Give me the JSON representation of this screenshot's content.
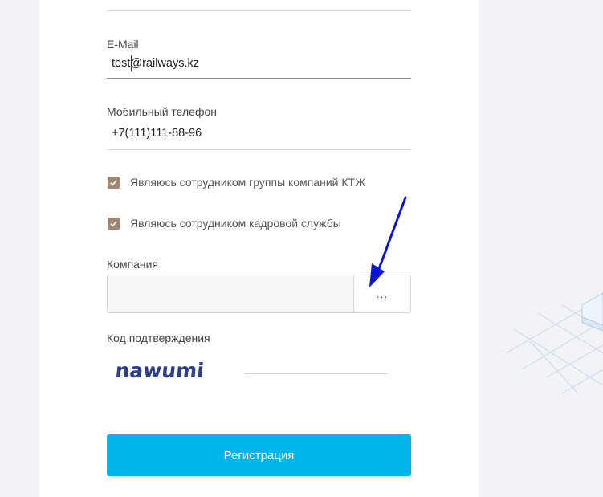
{
  "form": {
    "email": {
      "label": "E-Mail",
      "value": "test@railways.kz"
    },
    "phone": {
      "label": "Мобильный телефон",
      "value": "+7(111)111-88-96"
    },
    "checkbox_ktzh": {
      "label": "Являюсь сотрудником группы компаний КТЖ",
      "checked": true
    },
    "checkbox_hr": {
      "label": "Являюсь сотрудником кадровой службы",
      "checked": true
    },
    "company": {
      "label": "Компания",
      "value": "",
      "picker_label": "..."
    },
    "captcha": {
      "label": "Код подтверждения",
      "image_text": "nawumi",
      "value": ""
    },
    "submit_label": "Регистрация"
  },
  "colors": {
    "accent": "#00b4ec",
    "checkbox": "#9e8670",
    "annotation_arrow": "#0a14d6"
  }
}
